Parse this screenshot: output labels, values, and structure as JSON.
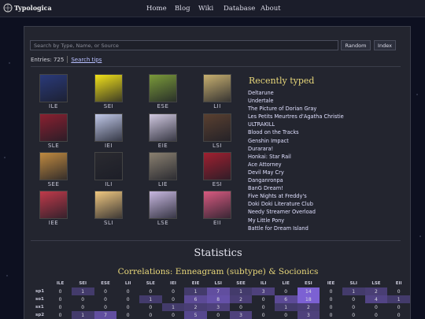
{
  "site": {
    "name": "Typologica",
    "nav": [
      "Home",
      "Blog",
      "Wiki",
      "Database",
      "About"
    ]
  },
  "search": {
    "placeholder": "Search by Type, Name, or Source",
    "random_label": "Random",
    "index_label": "Index"
  },
  "entries": {
    "text": "Entries: 725",
    "tips_label": "Search tips"
  },
  "grid": [
    {
      "label": "ILE",
      "color": "#2a3a7a"
    },
    {
      "label": "SEI",
      "color": "#f2e21a"
    },
    {
      "label": "ESE",
      "color": "#7a9a3a"
    },
    {
      "label": "LII",
      "color": "#c8b070"
    },
    {
      "label": "SLE",
      "color": "#8a2030"
    },
    {
      "label": "IEI",
      "color": "#c0c8e8"
    },
    {
      "label": "EIE",
      "color": "#d0c8e0"
    },
    {
      "label": "LSI",
      "color": "#5a4030"
    },
    {
      "label": "SEE",
      "color": "#c08a40"
    },
    {
      "label": "ILI",
      "color": "#2a2a30"
    },
    {
      "label": "LIE",
      "color": "#8a8070"
    },
    {
      "label": "ESI",
      "color": "#a02030"
    },
    {
      "label": "IEE",
      "color": "#c03a4a"
    },
    {
      "label": "SLI",
      "color": "#f0c880"
    },
    {
      "label": "LSE",
      "color": "#c8b8e0"
    },
    {
      "label": "EII",
      "color": "#d85a80"
    }
  ],
  "recent": {
    "title": "Recently typed",
    "items": [
      "Deltarune",
      "Undertale",
      "The Picture of Dorian Gray",
      "Les Petits Meurtres d'Agatha Christie",
      "ULTRAKILL",
      "Blood on the Tracks",
      "Genshin Impact",
      "Durarara!",
      "Honkai: Star Rail",
      "Ace Attorney",
      "Devil May Cry",
      "Danganronpa",
      "BanG Dream!",
      "Five Nights at Freddy's",
      "Doki Doki Literature Club",
      "Needy Streamer Overload",
      "My Little Pony",
      "Battle for Dream Island"
    ]
  },
  "stats": {
    "title": "Statistics",
    "correlation_title": "Correlations: Enneagram (subtype) & Socionics",
    "columns": [
      "ILE",
      "SEI",
      "ESE",
      "LII",
      "SLE",
      "IEI",
      "EIE",
      "LSI",
      "SEE",
      "ILI",
      "LIE",
      "ESI",
      "IEE",
      "SLI",
      "LSE",
      "EII"
    ],
    "rows": [
      {
        "label": "sp1",
        "values": [
          "0",
          "1",
          "0",
          "0",
          "0",
          "0",
          "1",
          "7",
          "1",
          "3",
          "0",
          "14",
          "0",
          "1",
          "2",
          "0"
        ]
      },
      {
        "label": "so1",
        "values": [
          "0",
          "0",
          "0",
          "0",
          "1",
          "0",
          "6",
          "8",
          "2",
          "0",
          "6",
          "18",
          "0",
          "0",
          "4",
          "1"
        ]
      },
      {
        "label": "sx1",
        "values": [
          "0",
          "0",
          "0",
          "0",
          "0",
          "1",
          "2",
          "3",
          "0",
          "0",
          "1",
          "2",
          "0",
          "0",
          "0",
          "0"
        ]
      },
      {
        "label": "sp2",
        "values": [
          "0",
          "1",
          "7",
          "0",
          "0",
          "0",
          "5",
          "0",
          "3",
          "0",
          "0",
          "3",
          "0",
          "0",
          "0",
          "0"
        ]
      }
    ]
  }
}
